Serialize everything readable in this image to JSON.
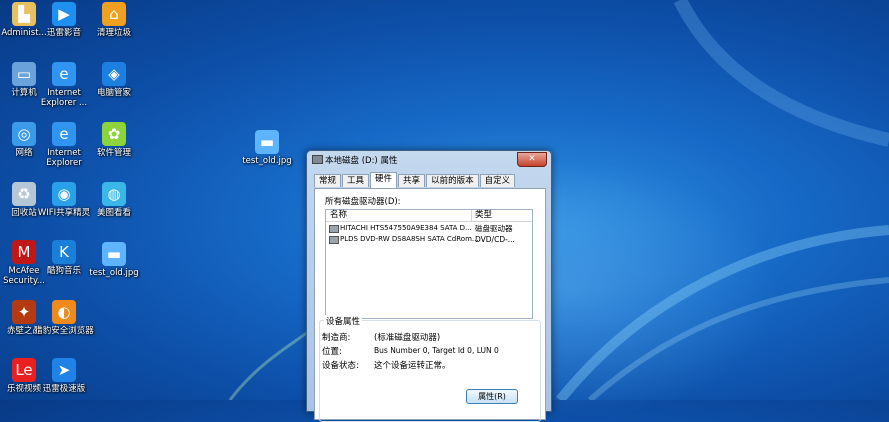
{
  "desktop": {
    "icons": [
      {
        "label": "Administ...",
        "icon": "user-folder-icon",
        "color": "#e8c060"
      },
      {
        "label": "迅雷影音",
        "icon": "play-circle-icon",
        "color": "#1f8ff0"
      },
      {
        "label": "清理垃圾",
        "icon": "broom-house-icon",
        "color": "#f0a020"
      },
      {
        "label": "计算机",
        "icon": "computer-icon",
        "color": "#6aa2dc"
      },
      {
        "label": "Internet Explorer ...",
        "icon": "internet-explorer-icon",
        "color": "#2f95f0"
      },
      {
        "label": "电脑管家",
        "icon": "shield-icon",
        "color": "#1d7fe0"
      },
      {
        "label": "网络",
        "icon": "network-globe-icon",
        "color": "#3c9be8"
      },
      {
        "label": "Internet Explorer",
        "icon": "internet-explorer-icon",
        "color": "#2f95f0"
      },
      {
        "label": "软件管理",
        "icon": "app-manager-icon",
        "color": "#8bd43c"
      },
      {
        "label": "回收站",
        "icon": "recycle-bin-icon",
        "color": "#b5c6d6"
      },
      {
        "label": "WIFI共享精灵",
        "icon": "wifi-icon",
        "color": "#2aa0e8"
      },
      {
        "label": "美图看看",
        "icon": "photo-viewer-icon",
        "color": "#38b7e8"
      },
      {
        "label": "McAfee Security...",
        "icon": "mcafee-shield-icon",
        "color": "#c01818"
      },
      {
        "label": "酷狗音乐",
        "icon": "kugou-music-icon",
        "color": "#1a7fd8"
      },
      {
        "label": "test_old.jpg",
        "icon": "image-file-icon",
        "color": "#5fb4ff"
      },
      {
        "label": "赤壁之战",
        "icon": "game-icon",
        "color": "#b43a14"
      },
      {
        "label": "猎豹安全浏览器",
        "icon": "cheetah-browser-icon",
        "color": "#f08a1a"
      },
      {
        "label": "乐视视频",
        "icon": "letv-icon",
        "color": "#e8201f"
      },
      {
        "label": "迅雷极速版",
        "icon": "thunder-icon",
        "color": "#1f82e6"
      },
      {
        "label": "test_old.jpg",
        "icon": "image-file-icon",
        "color": "#5fb4ff"
      }
    ]
  },
  "dialog": {
    "title": "本地磁盘 (D:) 属性",
    "close_glyph": "✕",
    "tabs": [
      "常规",
      "工具",
      "硬件",
      "共享",
      "以前的版本",
      "自定义"
    ],
    "active_tab": "硬件",
    "all_drives_label": "所有磁盘驱动器(D):",
    "columns": {
      "name": "名称",
      "type": "类型"
    },
    "drives": [
      {
        "name": "HITACHI HTS547550A9E384 SATA D...",
        "type": "磁盘驱动器"
      },
      {
        "name": "PLDS DVD-RW DS8A8SH SATA CdRom...",
        "type": "DVD/CD-..."
      }
    ],
    "device_properties": {
      "legend": "设备属性",
      "manufacturer_label": "制造商:",
      "manufacturer_value": "(标准磁盘驱动器)",
      "location_label": "位置:",
      "location_value": "Bus Number 0, Target Id 0, LUN 0",
      "status_label": "设备状态:",
      "status_value": "这个设备运转正常。"
    },
    "properties_button": "属性(R)"
  }
}
